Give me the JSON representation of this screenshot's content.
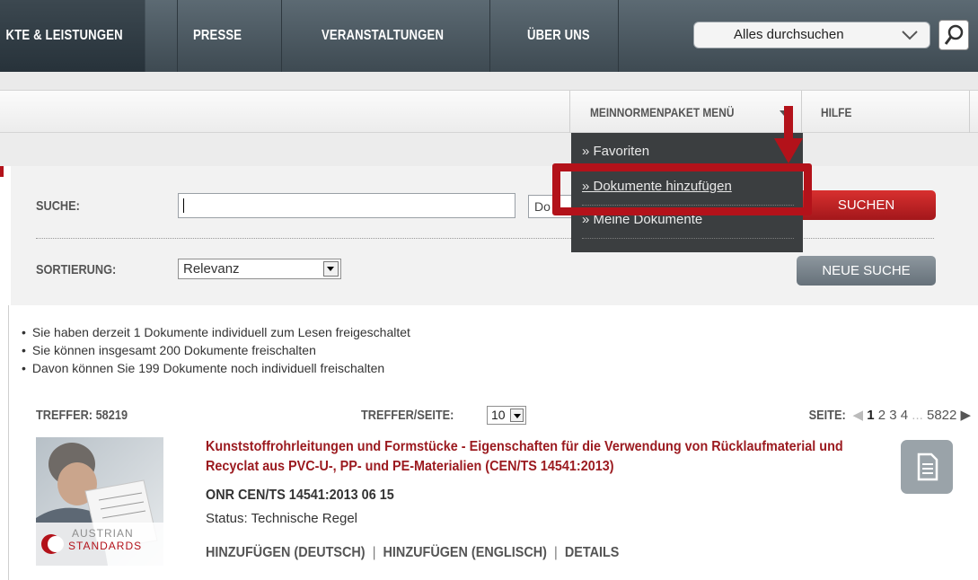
{
  "topnav": {
    "items": [
      "KTE & LEISTUNGEN",
      "PRESSE",
      "VERANSTALTUNGEN",
      "ÜBER UNS"
    ],
    "search_placeholder": "Alles durchsuchen"
  },
  "subnav": {
    "menu_label": "MEINNORMENPAKET MENÜ",
    "help_label": "HILFE"
  },
  "dropdown": {
    "items": [
      "» Favoriten",
      "» Dokumente hinzufügen",
      "» Meine Dokumente"
    ]
  },
  "search": {
    "label": "SUCHE:",
    "value": "",
    "doc_type": "Do",
    "submit_label": "SUCHEN",
    "sort_label": "SORTIERUNG:",
    "sort_value": "Relevanz",
    "new_search_label": "NEUE SUCHE"
  },
  "info": [
    "Sie haben derzeit 1 Dokumente individuell zum Lesen freigeschaltet",
    "Sie können insgesamt 200 Dokumente freischalten",
    "Davon können Sie 199 Dokumente noch individuell freischalten"
  ],
  "results_bar": {
    "hits_label": "TREFFER:",
    "hits_value": "58219",
    "per_page_label": "TREFFER/SEITE:",
    "per_page_value": "10",
    "page_label": "SEITE:",
    "pages": [
      "1",
      "2",
      "3",
      "4"
    ],
    "ellipsis": "...",
    "last_page": "5822"
  },
  "result": {
    "title": "Kunststoffrohrleitungen und Formstücke - Eigenschaften für die Verwendung von Rücklaufmaterial und Recyclat aus PVC-U-, PP- und PE-Materialien (CEN/TS 14541:2013)",
    "code": "ONR CEN/TS 14541:2013 06 15",
    "status": "Status: Technische Regel",
    "logo_line1": "AUSTRIAN",
    "logo_line2": "STANDARDS",
    "actions": [
      "HINZUFÜGEN (DEUTSCH)",
      "HINZUFÜGEN (ENGLISCH)",
      "DETAILS"
    ]
  },
  "colors": {
    "brand_red": "#b3121a",
    "nav_dark": "#3e4a52",
    "menu_bg": "#3b3e40",
    "title_red": "#9b1a1f"
  }
}
